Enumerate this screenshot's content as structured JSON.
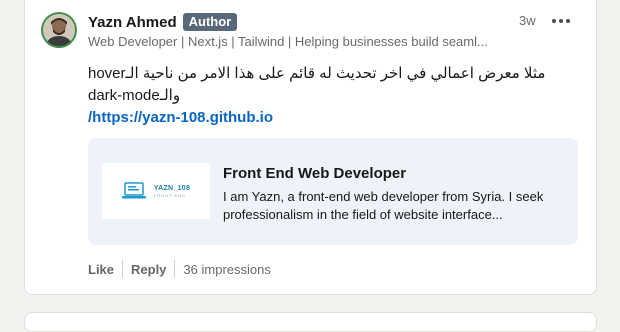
{
  "post": {
    "author_name": "Yazn Ahmed",
    "author_badge": "Author",
    "headline": "Web Developer | Next.js | Tailwind | Helping businesses build seaml...",
    "time": "3w",
    "text_line1": "مثلا معرض اعمالي في اخر تحديث له قائم على هذا الامر من ناحية الـhover",
    "text_line2": "والـdark-mode",
    "link": "/https://yazn-108.github.io"
  },
  "preview": {
    "title": "Front End Web Developer",
    "description": "I am Yazn, a front-end web developer from Syria. I seek professionalism in the field of website interface...",
    "logo_title": "YAZN_108",
    "logo_sub": "FRONT END"
  },
  "actions": {
    "like": "Like",
    "reply": "Reply",
    "impressions": "36 impressions"
  },
  "colors": {
    "link": "#0a66c2",
    "badge": "#56687a",
    "preview_bg": "#edf3f8"
  }
}
